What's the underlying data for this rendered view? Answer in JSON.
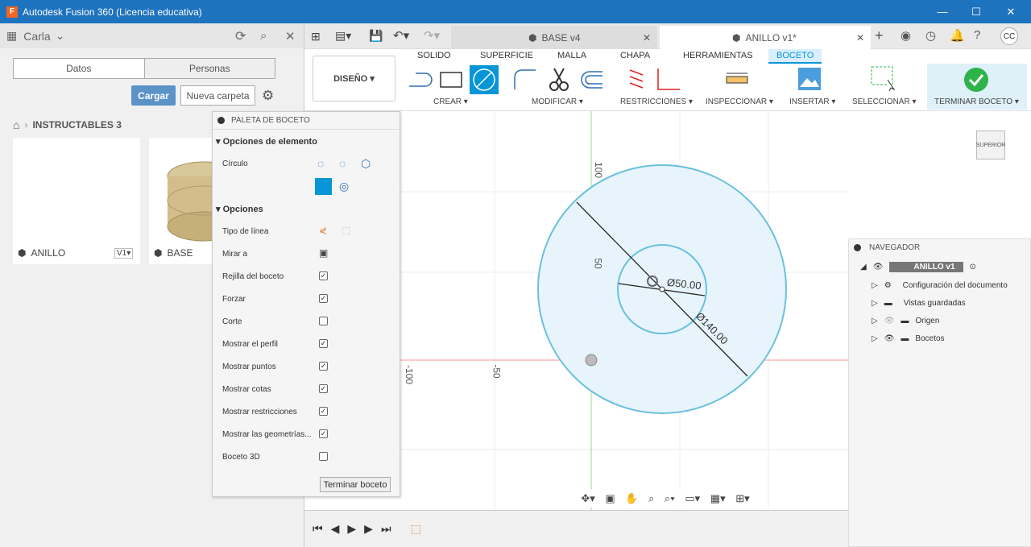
{
  "window": {
    "title": "Autodesk Fusion 360 (Licencia educativa)",
    "min": "—",
    "max": "☐",
    "close": "✕"
  },
  "user": {
    "name": "Carla"
  },
  "data_panel": {
    "tab_data": "Datos",
    "tab_people": "Personas",
    "upload": "Cargar",
    "new_folder": "Nueva carpeta",
    "breadcrumb": "INSTRUCTABLES 3",
    "cards": [
      {
        "name": "ANILLO",
        "version": "V1▾"
      },
      {
        "name": "BASE"
      }
    ]
  },
  "doc_tabs": [
    {
      "label": "BASE v4"
    },
    {
      "label": "ANILLO v1*"
    }
  ],
  "user_initials": "CC",
  "ribbon": {
    "workspace": "DISEÑO ▾",
    "tabs": [
      "SOLIDO",
      "SUPERFICIE",
      "MALLA",
      "CHAPA",
      "HERRAMIENTAS",
      "BOCETO"
    ],
    "groups": [
      "CREAR ▾",
      "MODIFICAR ▾",
      "RESTRICCIONES ▾",
      "INSPECCIONAR ▾",
      "INSERTAR ▾",
      "SELECCIONAR ▾",
      "TERMINAR BOCETO ▾"
    ]
  },
  "palette": {
    "title": "PALETA DE BOCETO",
    "sec1": "Opciones de elemento",
    "circle": "Círculo",
    "sec2": "Opciones",
    "rows": [
      {
        "label": "Tipo de línea"
      },
      {
        "label": "Mirar a"
      },
      {
        "label": "Rejilla del boceto",
        "checked": "✓"
      },
      {
        "label": "Forzar",
        "checked": "✓"
      },
      {
        "label": "Corte",
        "checked": ""
      },
      {
        "label": "Mostrar el perfil",
        "checked": "✓"
      },
      {
        "label": "Mostrar puntos",
        "checked": "✓"
      },
      {
        "label": "Mostrar cotas",
        "checked": "✓"
      },
      {
        "label": "Mostrar restricciones",
        "checked": "✓"
      },
      {
        "label": "Mostrar las geometrías...",
        "checked": "✓"
      },
      {
        "label": "Boceto 3D",
        "checked": ""
      }
    ],
    "finish": "Terminar boceto"
  },
  "canvas": {
    "dim_small": "Ø50.00",
    "dim_large": "Ø140.00",
    "tick_100": "100",
    "tick_50": "50",
    "tick_m100": "-100",
    "tick_m50": "-50",
    "viewcube": "SUPERIOR"
  },
  "navigator": {
    "title": "NAVEGADOR",
    "root": "ANILLO v1",
    "items": [
      "Configuración del documento",
      "Vistas guardadas",
      "Origen",
      "Bocetos"
    ]
  },
  "colors": {
    "accent": "#0696d7",
    "titlebar": "#1e73be",
    "circle_fill": "#e8f4fb",
    "circle_stroke": "#6ac0de",
    "finish_green": "#2db34a"
  }
}
